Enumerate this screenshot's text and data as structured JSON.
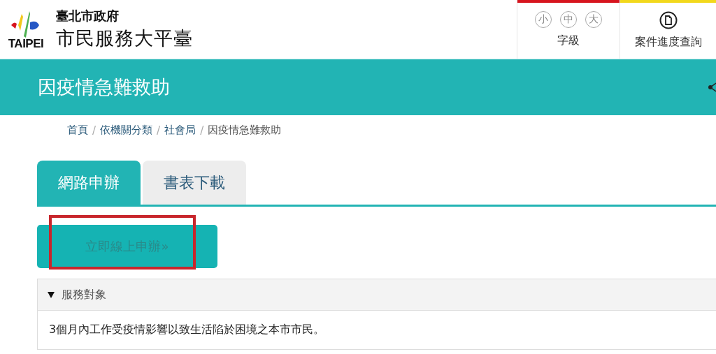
{
  "header": {
    "logo_text": "TAIPEI",
    "org": "臺北市政府",
    "platform": "市民服務大平臺"
  },
  "font_size": {
    "options": [
      "小",
      "中",
      "大"
    ],
    "label": "字級"
  },
  "case_query": {
    "label": "案件進度查詢"
  },
  "page_title": "因疫情急難救助",
  "breadcrumb": [
    {
      "label": "首頁",
      "separator": "/"
    },
    {
      "label": "依機關分類",
      "separator": "/"
    },
    {
      "label": "社會局",
      "separator": "/"
    },
    {
      "label": "因疫情急難救助"
    }
  ],
  "tabs": [
    {
      "label": "網路申辦",
      "selected": true
    },
    {
      "label": "書表下載",
      "selected": false
    }
  ],
  "apply_button": {
    "label": "立即線上申辦»",
    "highlighted": true
  },
  "accordion": {
    "title": "服務對象",
    "expanded": true,
    "body": "3個月內工作受疫情影響以致生活陷於困境之本市市民。"
  }
}
